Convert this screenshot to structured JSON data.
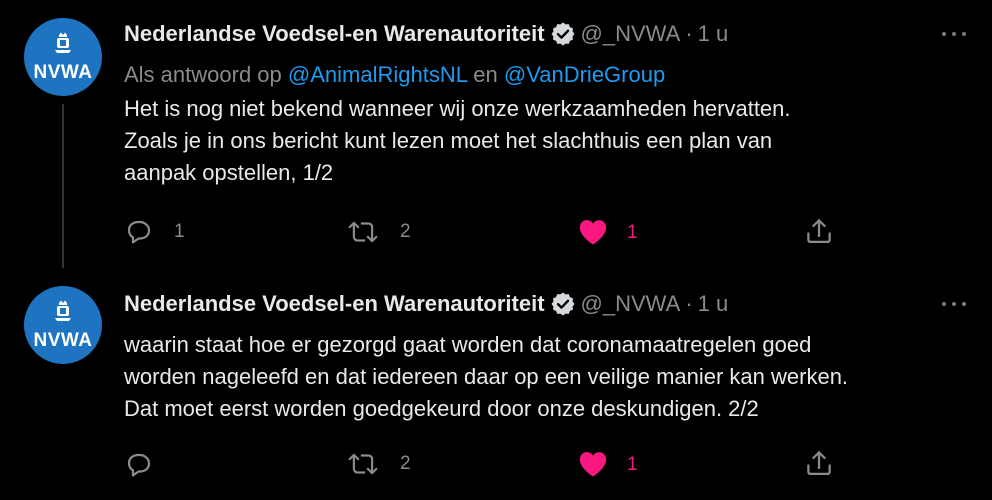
{
  "tweets": [
    {
      "author": {
        "name": "Nederlandse Voedsel-en Warenautoriteit",
        "handle": "@_NVWA",
        "separator": "·",
        "time": "1 u",
        "avatar_text": "NVWA"
      },
      "reply_to": {
        "prefix": "Als antwoord op",
        "mention_1": "@AnimalRightsNL",
        "joiner": "en",
        "mention_2": "@VanDrieGroup"
      },
      "text_lines": [
        "Het is nog niet bekend wanneer wij onze werkzaamheden hervatten.",
        "Zoals je in ons bericht kunt lezen moet het slachthuis een plan van",
        "aanpak opstellen, 1/2"
      ],
      "actions": {
        "reply_count": "1",
        "retweet_count": "2",
        "like_count": "1",
        "liked": true
      }
    },
    {
      "author": {
        "name": "Nederlandse Voedsel-en Warenautoriteit",
        "handle": "@_NVWA",
        "separator": "·",
        "time": "1 u",
        "avatar_text": "NVWA"
      },
      "text_lines": [
        "waarin staat hoe er gezorgd gaat worden dat coronamaatregelen goed",
        "worden nageleefd en dat iedereen daar op een veilige manier kan werken.",
        "Dat moet eerst worden goedgekeurd door onze deskundigen. 2/2"
      ],
      "actions": {
        "reply_count": "",
        "retweet_count": "2",
        "like_count": "1",
        "liked": true
      }
    }
  ],
  "colors": {
    "background": "#000000",
    "text": "#e7e9ea",
    "muted": "#8b8b8b",
    "mention": "#1d9bf0",
    "like": "#f91880",
    "avatar": "#1f74c2"
  },
  "icons": [
    "verified-badge-icon",
    "more-options-icon",
    "reply-icon",
    "retweet-icon",
    "like-heart-icon",
    "share-icon",
    "royal-crest-icon"
  ]
}
